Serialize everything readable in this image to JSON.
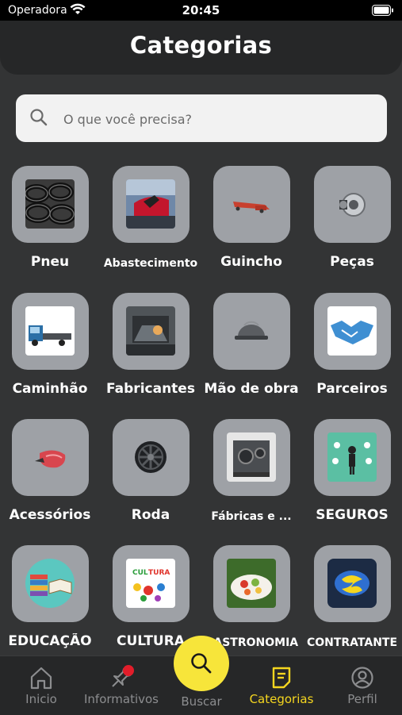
{
  "status_bar": {
    "carrier": "Operadora",
    "time": "20:45"
  },
  "header": {
    "title": "Categorias"
  },
  "search": {
    "placeholder": "O que você precisa?"
  },
  "categories": [
    {
      "label": "Pneu",
      "icon": "tires-icon"
    },
    {
      "label": "Abastecimento",
      "icon": "fuel-pump-icon"
    },
    {
      "label": "Guincho",
      "icon": "tow-truck-icon"
    },
    {
      "label": "Peças",
      "icon": "alternator-icon"
    },
    {
      "label": "Caminhão",
      "icon": "truck-icon"
    },
    {
      "label": "Fabricantes",
      "icon": "factory-icon"
    },
    {
      "label": "Mão de obra",
      "icon": "hard-hat-icon"
    },
    {
      "label": "Parceiros",
      "icon": "handshake-icon"
    },
    {
      "label": "Acessórios",
      "icon": "side-mirror-icon"
    },
    {
      "label": "Roda",
      "icon": "wheel-rim-icon"
    },
    {
      "label": "Fábricas e ...",
      "icon": "engine-icon"
    },
    {
      "label": "SEGUROS",
      "icon": "insurance-icon"
    },
    {
      "label": "EDUCAÇÃO",
      "icon": "books-icon"
    },
    {
      "label": "CULTURA",
      "icon": "culture-icon"
    },
    {
      "label": "GASTRONOMIA",
      "icon": "food-plate-icon"
    },
    {
      "label": "CONTRATANTE",
      "icon": "contractor-logo-icon"
    }
  ],
  "nav": {
    "inicio": "Inicio",
    "informativos": "Informativos",
    "buscar": "Buscar",
    "categorias": "Categorias",
    "perfil": "Perfil"
  },
  "colors": {
    "accent": "#f5d61f",
    "fab": "#f7e53a",
    "badge": "#e11d2a",
    "background": "#333435"
  }
}
